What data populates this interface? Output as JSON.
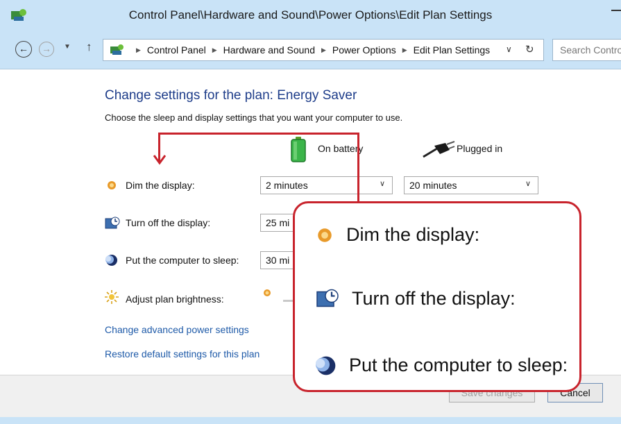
{
  "window": {
    "title": "Control Panel\\Hardware and Sound\\Power Options\\Edit Plan Settings"
  },
  "address_bar": {
    "crumbs": [
      "Control Panel",
      "Hardware and Sound",
      "Power Options",
      "Edit Plan Settings"
    ],
    "search_placeholder": "Search Control Panel"
  },
  "page": {
    "heading": "Change settings for the plan: Energy Saver",
    "subtitle": "Choose the sleep and display settings that you want your computer to use.",
    "columns": {
      "battery": "On battery",
      "plugged": "Plugged in"
    },
    "rows": [
      {
        "label": "Dim the display:",
        "battery": "2 minutes",
        "plugged": "20 minutes"
      },
      {
        "label": "Turn off the display:",
        "battery": "25 mi"
      },
      {
        "label": "Put the computer to sleep:",
        "battery": "30 mi"
      },
      {
        "label": "Adjust plan brightness:"
      }
    ],
    "links": {
      "advanced": "Change advanced power settings",
      "restore": "Restore default settings for this plan"
    },
    "buttons": {
      "save": "Save changes",
      "cancel": "Cancel"
    }
  },
  "zoom_callout": {
    "items": [
      "Dim the display:",
      "Turn off the display:",
      "Put the computer to sleep:"
    ]
  },
  "colors": {
    "accent_heading": "#1e3d8a",
    "link": "#1e5aa8",
    "callout_border": "#c8232c",
    "chrome": "#c9e3f7"
  }
}
